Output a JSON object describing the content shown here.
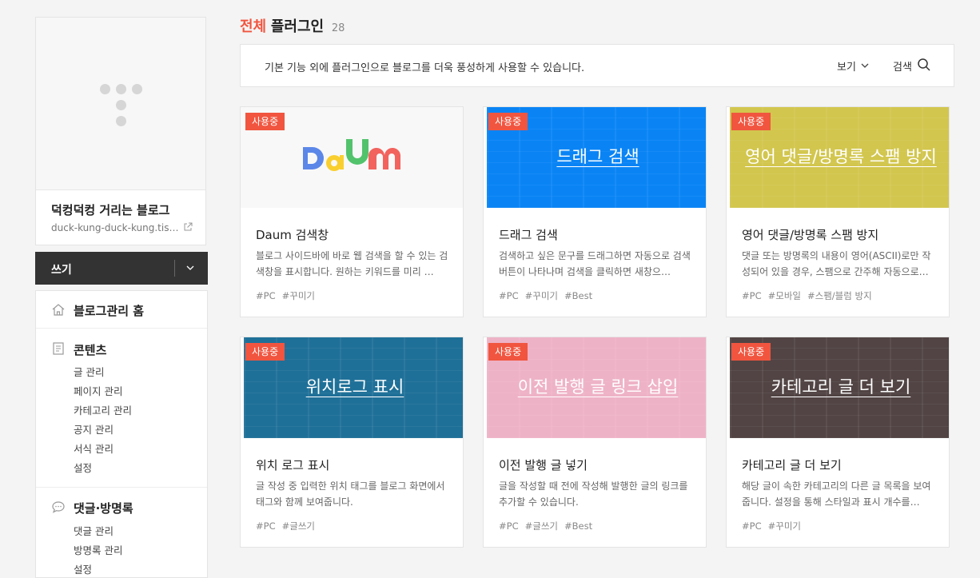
{
  "blog": {
    "title": "덕컹덕컹 거리는 블로그",
    "url": "duck-kung-duck-kung.tisto…"
  },
  "write": {
    "label": "쓰기"
  },
  "menu": {
    "home": "블로그관리 홈",
    "contents": {
      "title": "콘텐츠",
      "items": [
        "글 관리",
        "페이지 관리",
        "카테고리 관리",
        "공지 관리",
        "서식 관리",
        "설정"
      ]
    },
    "comments": {
      "title": "댓글·방명록",
      "items": [
        "댓글 관리",
        "방명록 관리",
        "설정"
      ]
    }
  },
  "page": {
    "accent": "전체",
    "name": "플러그인",
    "count": "28"
  },
  "info_bar": {
    "text": "기본 기능 외에 플러그인으로 블로그를 더욱 풍성하게 사용할 수 있습니다.",
    "view_label": "보기",
    "search_label": "검색"
  },
  "cards": [
    {
      "badge": "사용중",
      "thumb_title": "",
      "thumb_color": "#f8f8f8",
      "name": "Daum 검색창",
      "desc": "블로그 사이드바에 바로 웹 검색을 할 수 있는 검색창을 표시합니다. 원하는 키워드를 미리 …",
      "tags": [
        "#PC",
        "#꾸미기"
      ]
    },
    {
      "badge": "사용중",
      "thumb_title": "드래그 검색",
      "thumb_color": "#0a84f5",
      "name": "드래그 검색",
      "desc": "검색하고 싶은 문구를 드래그하면 자동으로 검색 버튼이 나타나며 검색을 클릭하면 새창으…",
      "tags": [
        "#PC",
        "#꾸미기",
        "#Best"
      ]
    },
    {
      "badge": "사용중",
      "thumb_title": "영어 댓글/방명록 스팸 방지",
      "thumb_color": "#d2c64e",
      "name": "영어 댓글/방명록 스팸 방지",
      "desc": "댓글 또는 방명록의 내용이 영어(ASCII)로만 작성되어 있을 경우, 스팸으로 간주해 자동으로…",
      "tags": [
        "#PC",
        "#모바일",
        "#스팸/블럼 방지"
      ]
    },
    {
      "badge": "사용중",
      "thumb_title": "위치로그 표시",
      "thumb_color": "#1f7098",
      "name": "위치 로그 표시",
      "desc": "글 작성 중 입력한 위치 태그를 블로그 화면에서 태그와 함께 보여줍니다.",
      "tags": [
        "#PC",
        "#글쓰기"
      ]
    },
    {
      "badge": "사용중",
      "thumb_title": "이전 발행 글 링크 삽입",
      "thumb_color": "#eeb2c6",
      "name": "이전 발행 글 넣기",
      "desc": "글을 작성할 때 전에 작성해 발행한 글의 링크를 추가할 수 있습니다.",
      "tags": [
        "#PC",
        "#글쓰기",
        "#Best"
      ]
    },
    {
      "badge": "사용중",
      "thumb_title": "카테고리 글 더 보기",
      "thumb_color": "#524444",
      "name": "카테고리 글 더 보기",
      "desc": "해당 글이 속한 카테고리의 다른 글 목록을 보여줍니다. 설정을 통해 스타일과 표시 개수를…",
      "tags": [
        "#PC",
        "#꾸미기"
      ]
    }
  ]
}
